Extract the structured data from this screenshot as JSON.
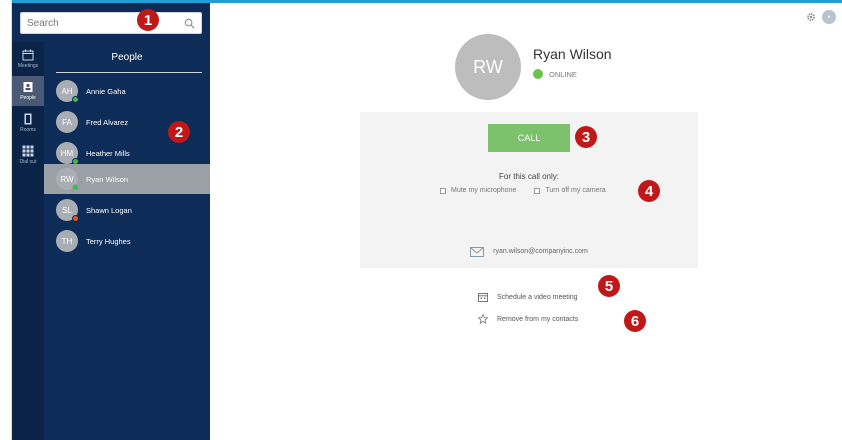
{
  "search": {
    "placeholder": "Search"
  },
  "rail": {
    "items": [
      {
        "label": "Meetings",
        "icon": "calendar-icon"
      },
      {
        "label": "People",
        "icon": "contact-card-icon"
      },
      {
        "label": "Rooms",
        "icon": "room-icon"
      },
      {
        "label": "Dial out",
        "icon": "dialpad-icon"
      }
    ]
  },
  "people": {
    "title": "People",
    "contacts": [
      {
        "initials": "AH",
        "name": "Annie Gaha",
        "presence": "#3dbb4d"
      },
      {
        "initials": "FA",
        "name": "Fred Alvarez",
        "presence": ""
      },
      {
        "initials": "HM",
        "name": "Heather Mills",
        "presence": "#3dbb4d"
      },
      {
        "initials": "RW",
        "name": "Ryan Wilson",
        "presence": "#3dbb4d"
      },
      {
        "initials": "SL",
        "name": "Shawn Logan",
        "presence": "#e5561f"
      },
      {
        "initials": "TH",
        "name": "Terry Hughes",
        "presence": ""
      }
    ]
  },
  "profile": {
    "initials": "RW",
    "name": "Ryan Wilson",
    "status": "ONLINE"
  },
  "call": {
    "button": "CALL",
    "only_label": "For this call only:",
    "mute": "Mute my microphone",
    "camera": "Turn off my camera"
  },
  "email": "ryan.wilson@companyinc.com",
  "actions": {
    "schedule": "Schedule a video meeting",
    "remove": "Remove from my contacts"
  },
  "badges": [
    "1",
    "2",
    "3",
    "4",
    "5",
    "6"
  ],
  "colors": {
    "sidebar": "#0d2c57",
    "accent": "#1f9fd6",
    "call": "#7cc16b",
    "badge": "#c01818",
    "online": "#6cc24a"
  }
}
